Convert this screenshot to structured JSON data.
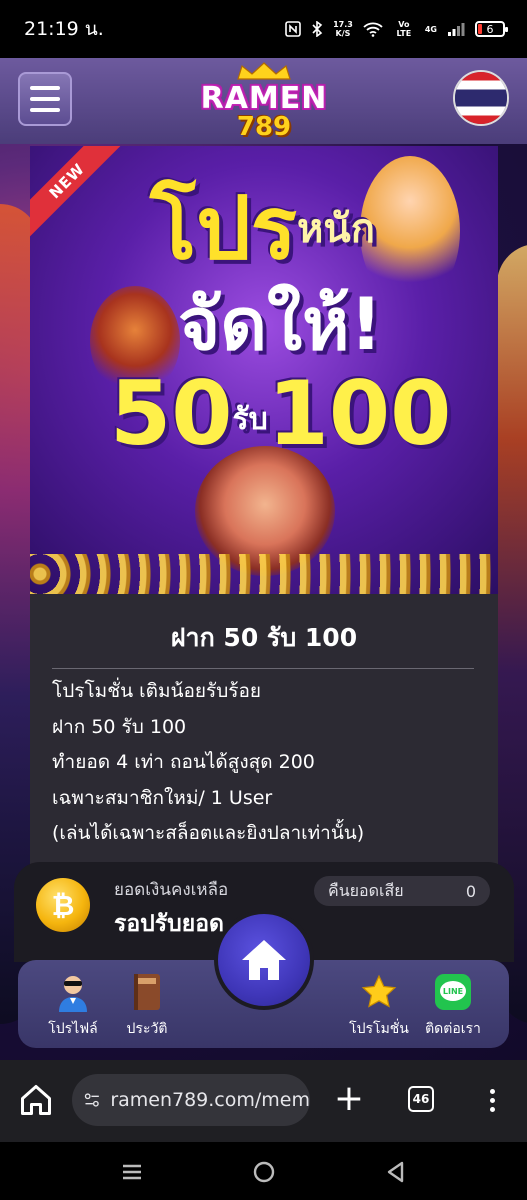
{
  "status_bar": {
    "time": "21:19 น.",
    "net_speed": "17.3",
    "net_unit": "K/S",
    "volte": "Vo LTE",
    "network": "4G",
    "battery": "6"
  },
  "header": {
    "logo_top": "RAMEN",
    "logo_bottom": "789"
  },
  "promo_banner": {
    "ribbon": "NEW",
    "line1_main": "โปร",
    "line1_small": "หนัก",
    "line2": "จัดให้!",
    "line3_left": "50",
    "line3_mid": "รับ",
    "line3_right": "100"
  },
  "promo": {
    "title": "ฝาก 50 รับ 100",
    "lines": [
      "โปรโมชั่น เติมน้อยรับร้อย",
      "ฝาก 50 รับ 100",
      "ทำยอด 4 เท่า ถอนได้สูงสุด 200",
      "เฉพาะสมาชิกใหม่/ 1 User",
      "(เล่นได้เฉพาะสล็อตและยิงปลาเท่านั้น)"
    ]
  },
  "balance": {
    "label": "ยอดเงินคงเหลือ",
    "value": "รอปรับยอด",
    "cashback_label": "คืนยอดเสีย",
    "cashback_value": "0"
  },
  "bottom_nav": {
    "items": [
      {
        "label": "โปรไฟล์",
        "icon": "profile-avatar-icon"
      },
      {
        "label": "ประวัติ",
        "icon": "history-book-icon"
      },
      {
        "label": "โปรโมชั่น",
        "icon": "star-icon"
      },
      {
        "label": "ติดต่อเรา",
        "icon": "line-chat-icon"
      }
    ],
    "home_icon": "home-icon"
  },
  "browser": {
    "url": "ramen789.com/mem",
    "tab_count": "46"
  },
  "colors": {
    "header_bg": "#5d4d92",
    "card_bg": "#2c2a33",
    "nav_bg": "#4c4980",
    "home_btn": "#3f36b8",
    "promo_yellow": "#ffe12a"
  }
}
